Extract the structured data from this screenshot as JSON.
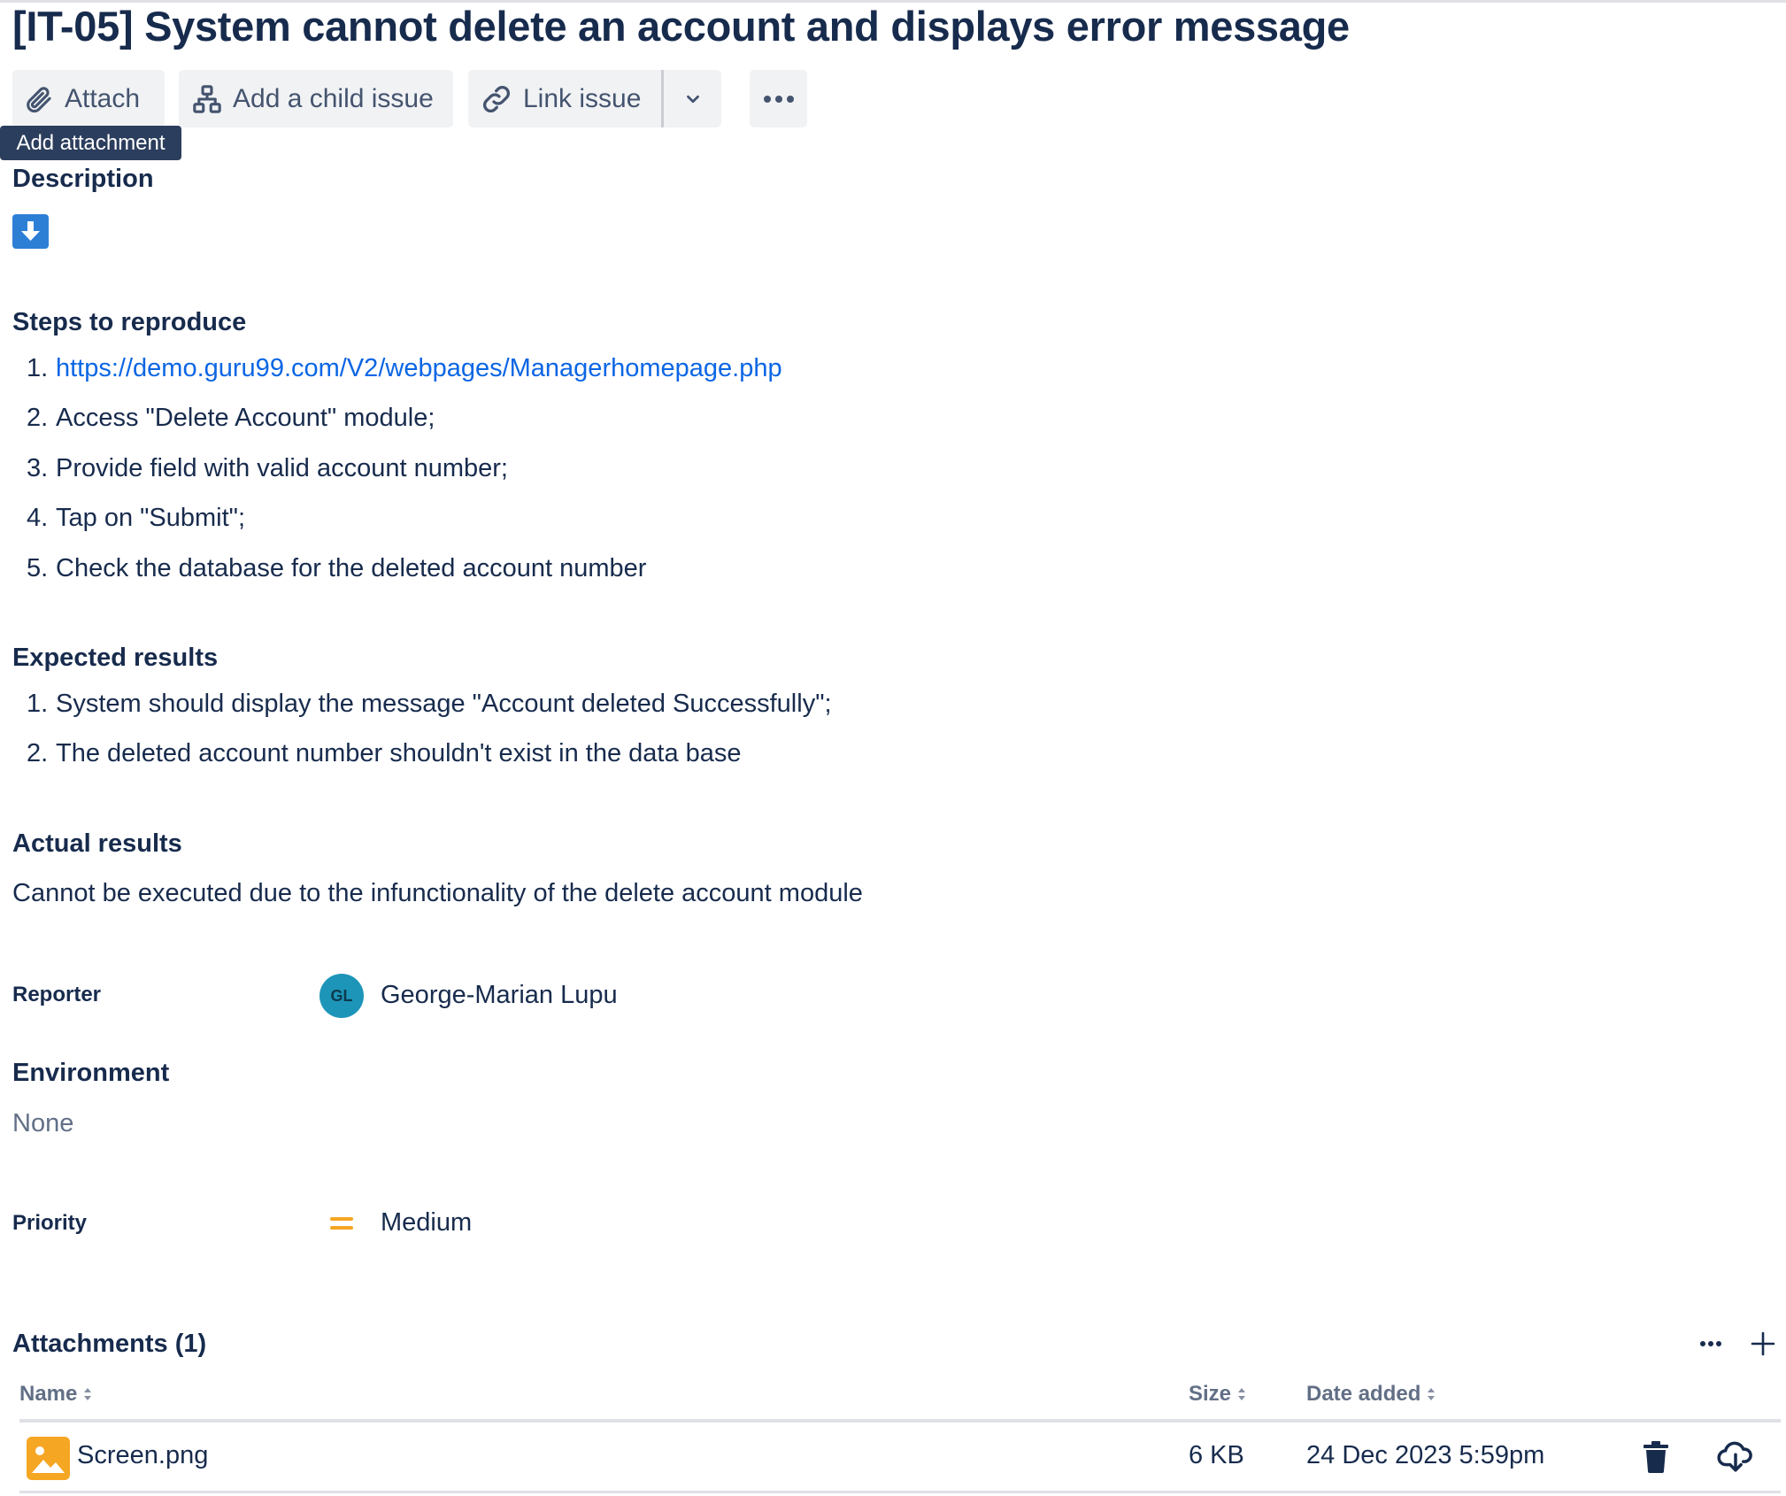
{
  "issue": {
    "title": "[IT-05] System cannot delete an account and displays error message"
  },
  "toolbar": {
    "attach_label": "Attach",
    "add_child_label": "Add a child issue",
    "link_issue_label": "Link issue",
    "tooltip": "Add attachment"
  },
  "description": {
    "heading": "Description",
    "steps_heading": "Steps to reproduce",
    "steps": [
      {
        "num": "1.",
        "text": "https://demo.guru99.com/V2/webpages/Managerhomepage.php"
      },
      {
        "num": "2.",
        "text": "Access \"Delete Account\" module;"
      },
      {
        "num": "3.",
        "text": "Provide field with valid account number;"
      },
      {
        "num": "4.",
        "text": "Tap on \"Submit\";"
      },
      {
        "num": "5.",
        "text": "Check the database for the deleted account number"
      }
    ],
    "expected_heading": "Expected results",
    "expected": [
      {
        "num": "1.",
        "text": "System should display the message \"Account deleted Successfully\";"
      },
      {
        "num": "2.",
        "text": "The deleted account number shouldn't exist in the data base"
      }
    ],
    "actual_heading": "Actual results",
    "actual_text": "Cannot be executed due to the infunctionality of the delete account module"
  },
  "fields": {
    "reporter_label": "Reporter",
    "reporter_initials": "GL",
    "reporter_name": "George-Marian Lupu",
    "environment_label": "Environment",
    "environment_value": "None",
    "priority_label": "Priority",
    "priority_value": "Medium"
  },
  "attachments": {
    "heading": "Attachments (1)",
    "columns": {
      "name": "Name",
      "size": "Size",
      "date": "Date added"
    },
    "rows": [
      {
        "name": "Screen.png",
        "size": "6 KB",
        "date": "24 Dec 2023 5:59pm"
      }
    ]
  },
  "colors": {
    "link": "#0c66e4",
    "avatar": "#1d95b9",
    "priority_medium": "#f5a623",
    "text": "#172b4d"
  },
  "icons": [
    "paperclip-icon",
    "hierarchy-icon",
    "link-icon",
    "chevron-down-icon",
    "more-icon",
    "download-arrow-icon",
    "priority-medium-icon",
    "plus-icon",
    "image-file-icon",
    "trash-icon",
    "cloud-download-icon",
    "sort-icon"
  ]
}
